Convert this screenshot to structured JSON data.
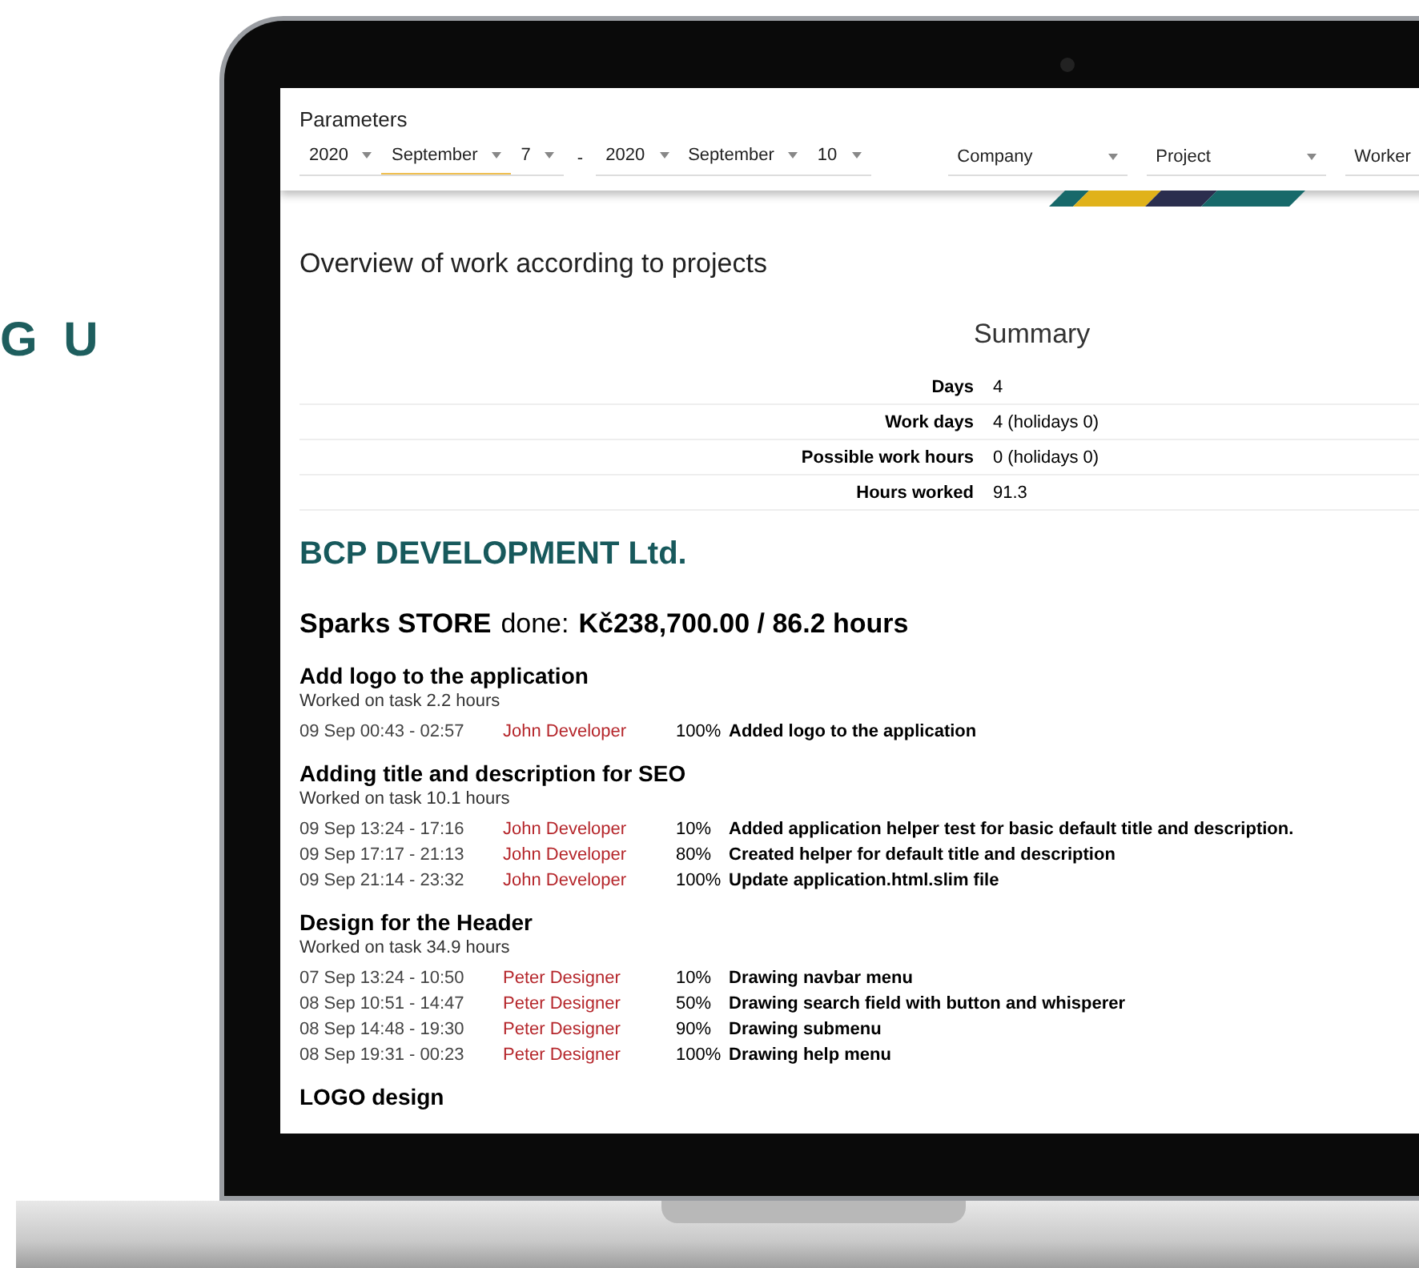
{
  "side_text": "G U",
  "parameters": {
    "title": "Parameters",
    "date_from": [
      {
        "value": "2020",
        "focused": false
      },
      {
        "value": "September",
        "focused": true
      },
      {
        "value": "7",
        "focused": false
      }
    ],
    "separator": "-",
    "date_to": [
      {
        "value": "2020",
        "focused": false
      },
      {
        "value": "September",
        "focused": false
      },
      {
        "value": "10",
        "focused": false
      }
    ],
    "filters": [
      {
        "value": "Company"
      },
      {
        "value": "Project"
      },
      {
        "value": "Worker"
      }
    ]
  },
  "page_title": "Overview of work according to projects",
  "summary": {
    "title": "Summary",
    "rows": [
      {
        "label": "Days",
        "value": "4"
      },
      {
        "label": "Work days",
        "value": "4 (holidays 0)"
      },
      {
        "label": "Possible work hours",
        "value": "0 (holidays 0)"
      },
      {
        "label": "Hours worked",
        "value": "91.3"
      }
    ]
  },
  "company": "BCP DEVELOPMENT Ltd.",
  "project": {
    "name": "Sparks STORE",
    "done_label": "done:",
    "done_value": "Kč238,700.00 / 86.2 hours"
  },
  "tasks": [
    {
      "title": "Add logo to the application",
      "worked": "Worked on task 2.2 hours",
      "entries": [
        {
          "time": "09 Sep 00:43 - 02:57",
          "worker": "John Developer",
          "percent": "100%",
          "note": "Added logo to the application"
        }
      ]
    },
    {
      "title": "Adding title and description for SEO",
      "worked": "Worked on task 10.1 hours",
      "entries": [
        {
          "time": "09 Sep 13:24 - 17:16",
          "worker": "John Developer",
          "percent": "10%",
          "note": "Added application helper test for basic default title and description."
        },
        {
          "time": "09 Sep 17:17 - 21:13",
          "worker": "John Developer",
          "percent": "80%",
          "note": "Created helper for default title and description"
        },
        {
          "time": "09 Sep 21:14 - 23:32",
          "worker": "John Developer",
          "percent": "100%",
          "note": "Update application.html.slim file"
        }
      ]
    },
    {
      "title": "Design for the Header",
      "worked": "Worked on task 34.9 hours",
      "entries": [
        {
          "time": "07 Sep 13:24 - 10:50",
          "worker": "Peter Designer",
          "percent": "10%",
          "note": "Drawing navbar menu"
        },
        {
          "time": "08 Sep 10:51 - 14:47",
          "worker": "Peter Designer",
          "percent": "50%",
          "note": "Drawing search field with button and whisperer"
        },
        {
          "time": "08 Sep 14:48 - 19:30",
          "worker": "Peter Designer",
          "percent": "90%",
          "note": "Drawing submenu"
        },
        {
          "time": "08 Sep 19:31 - 00:23",
          "worker": "Peter Designer",
          "percent": "100%",
          "note": "Drawing help menu"
        }
      ]
    },
    {
      "title": "LOGO design"
    }
  ]
}
